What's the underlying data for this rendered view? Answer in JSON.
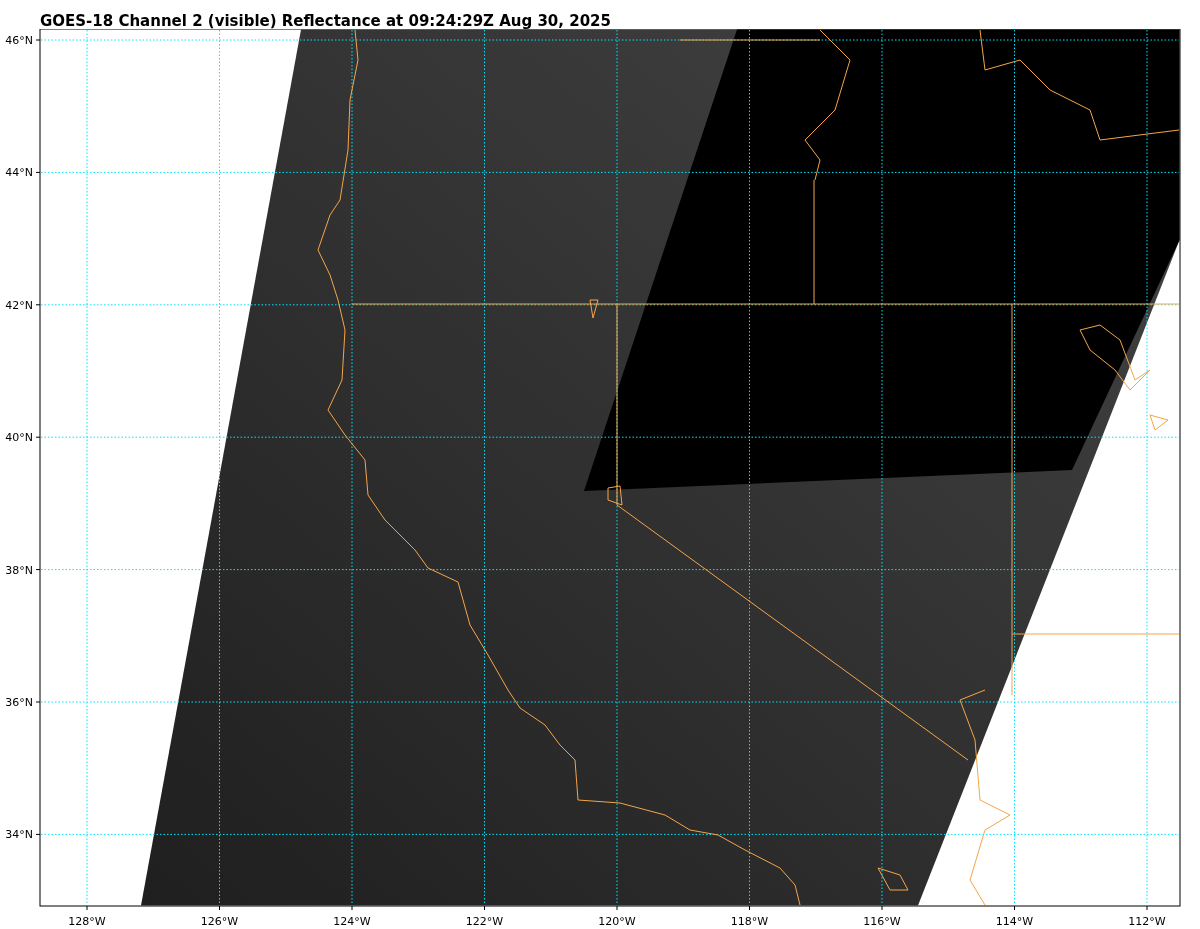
{
  "title": "GOES-18 Channel 2 (visible) Reflectance at 09:24:29Z Aug 30, 2025",
  "map": {
    "lat_ticks": [
      "46°N",
      "44°N",
      "42°N",
      "40°N",
      "38°N",
      "36°N",
      "34°N"
    ],
    "lon_ticks": [
      "128°W",
      "126°W",
      "124°W",
      "122°W",
      "120°W",
      "118°W",
      "116°W",
      "114°W",
      "112°W"
    ]
  }
}
